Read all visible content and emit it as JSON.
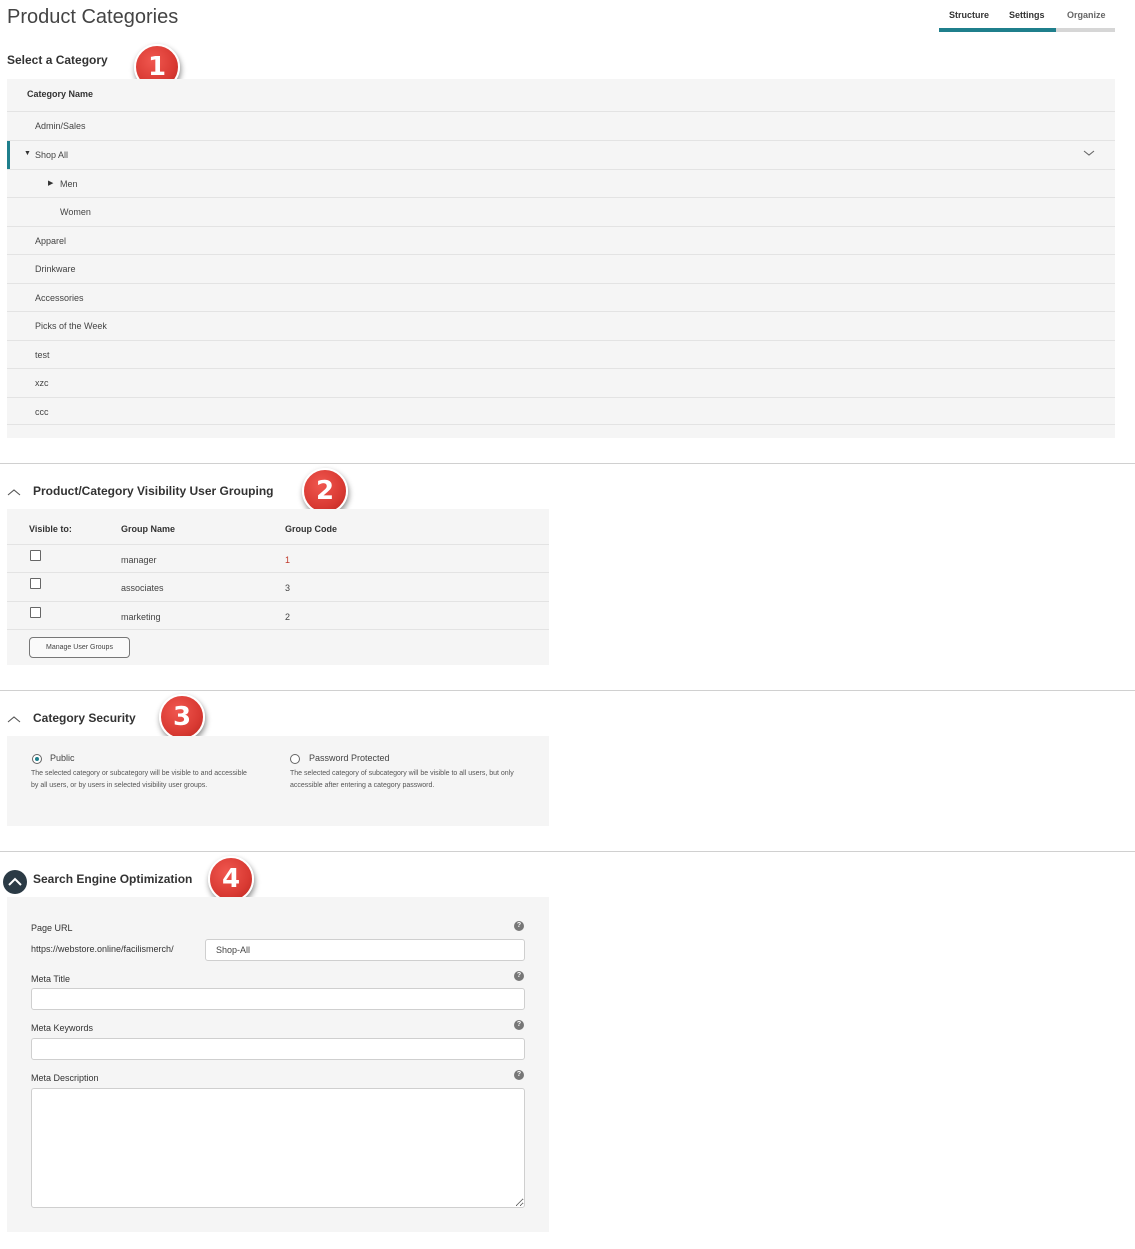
{
  "page": {
    "title": "Product Categories"
  },
  "tabs": [
    {
      "label": "Structure"
    },
    {
      "label": "Settings"
    },
    {
      "label": "Organize"
    }
  ],
  "badges": [
    "1",
    "2",
    "3",
    "4"
  ],
  "select_category": {
    "heading": "Select a Category",
    "column_header": "Category Name",
    "rows": [
      {
        "label": "Admin/Sales"
      },
      {
        "label": "Shop All"
      },
      {
        "label": "Men"
      },
      {
        "label": "Women"
      },
      {
        "label": "Apparel"
      },
      {
        "label": "Drinkware"
      },
      {
        "label": "Accessories"
      },
      {
        "label": "Picks of the Week"
      },
      {
        "label": "test"
      },
      {
        "label": "xzc"
      },
      {
        "label": "ccc"
      }
    ]
  },
  "visibility": {
    "heading": "Product/Category Visibility User Grouping",
    "columns": {
      "visible_to": "Visible to:",
      "group_name": "Group Name",
      "group_code": "Group Code"
    },
    "rows": [
      {
        "name": "manager",
        "code": "1",
        "checked": false
      },
      {
        "name": "associates",
        "code": "3",
        "checked": false
      },
      {
        "name": "marketing",
        "code": "2",
        "checked": false
      }
    ],
    "manage_button": "Manage User Groups"
  },
  "security": {
    "heading": "Category Security",
    "options": [
      {
        "label": "Public",
        "selected": true,
        "description": "The selected category or subcategory will be visible to and accessible by all users, or by users in selected visibility user groups."
      },
      {
        "label": "Password Protected",
        "selected": false,
        "description": "The selected category of subcategory will be visible to all users, but only accessible after entering a category password."
      }
    ]
  },
  "seo": {
    "heading": "Search Engine Optimization",
    "page_url_label": "Page URL",
    "url_prefix": "https://webstore.online/facilismerch/",
    "url_slug": "Shop-All",
    "meta_title_label": "Meta Title",
    "meta_title_value": "",
    "meta_keywords_label": "Meta Keywords",
    "meta_keywords_value": "",
    "meta_description_label": "Meta Description",
    "meta_description_value": "",
    "help_glyph": "?"
  },
  "colors": {
    "accent": "#1f7f8c",
    "badge": "#d93a33",
    "panel": "#f5f5f5"
  }
}
